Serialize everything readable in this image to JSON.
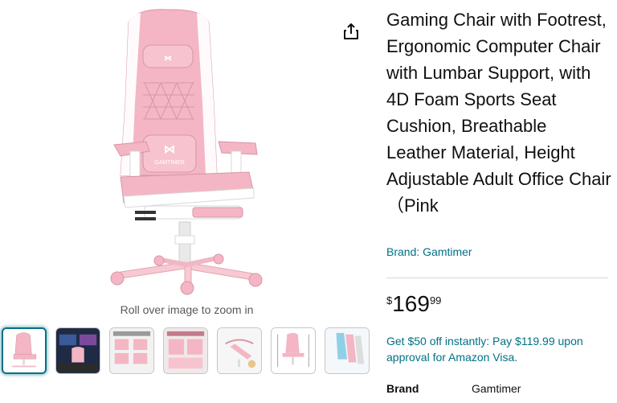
{
  "product": {
    "title": "Gaming Chair with Footrest, Ergonomic Computer Chair with Lumbar Support, with 4D Foam Sports Seat Cushion, Breathable Leather Material, Height Adjustable Adult Office Chair（Pink",
    "brand_link": "Brand: Gamtimer",
    "chair_logo_text": "GAMTIMER"
  },
  "price": {
    "symbol": "$",
    "whole": "169",
    "fraction": "99"
  },
  "offer": {
    "text": "Get $50 off instantly: Pay $119.99 upon approval for Amazon Visa."
  },
  "gallery": {
    "zoom_hint": "Roll over image to zoom in",
    "thumbnail_count": 7,
    "selected_index": 0
  },
  "specs": [
    {
      "label": "Brand",
      "value": "Gamtimer"
    }
  ],
  "icons": {
    "share": "share-icon"
  },
  "colors": {
    "link": "#007185",
    "chair_pink": "#f4b6c4",
    "selected_border": "#007185"
  }
}
